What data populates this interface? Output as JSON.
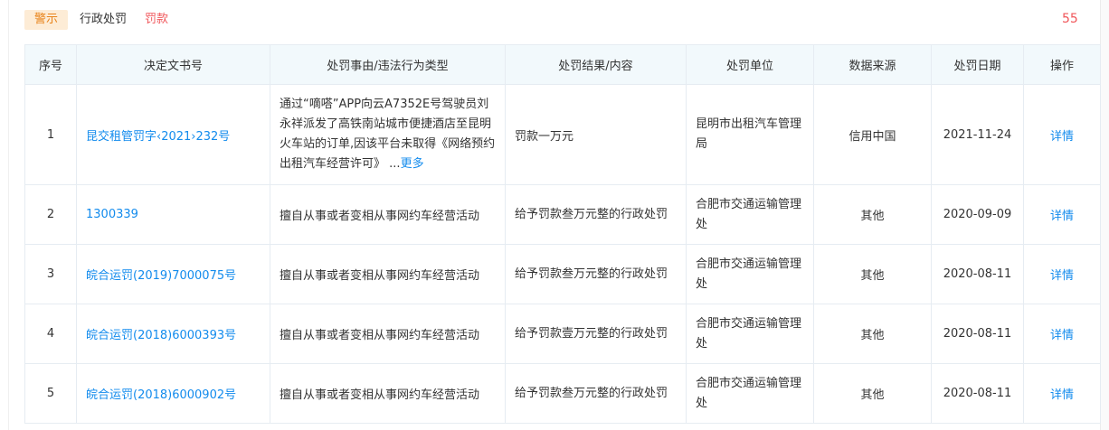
{
  "tabs": {
    "warning": "警示",
    "admin_penalty": "行政处罚",
    "fine": "罚款"
  },
  "count": "55",
  "table": {
    "headers": [
      "序号",
      "决定文书号",
      "处罚事由/违法行为类型",
      "处罚结果/内容",
      "处罚单位",
      "数据来源",
      "处罚日期",
      "操作"
    ],
    "rows": [
      {
        "index": "1",
        "doc_no": "昆交租管罚字‹2021›232号",
        "reason": "通过“嘀嗒”APP向云A7352E号驾驶员刘永祥派发了高铁南站城市便捷酒店至昆明火车站的订单,因该平台未取得《网络预约出租汽车经营许可》",
        "reason_ellipsis": "...",
        "reason_more": "更多",
        "result": "罚款一万元",
        "unit": "昆明市出租汽车管理局",
        "source": "信用中国",
        "date": "2021-11-24",
        "action": "详情"
      },
      {
        "index": "2",
        "doc_no": "1300339",
        "reason": "擅自从事或者变相从事网约车经营活动",
        "result": "给予罚款叁万元整的行政处罚",
        "unit": "合肥市交通运输管理处",
        "source": "其他",
        "date": "2020-09-09",
        "action": "详情"
      },
      {
        "index": "3",
        "doc_no": "皖合运罚(2019)7000075号",
        "reason": "擅自从事或者变相从事网约车经营活动",
        "result": "给予罚款叁万元整的行政处罚",
        "unit": "合肥市交通运输管理处",
        "source": "其他",
        "date": "2020-08-11",
        "action": "详情"
      },
      {
        "index": "4",
        "doc_no": "皖合运罚(2018)6000393号",
        "reason": "擅自从事或者变相从事网约车经营活动",
        "result": "给予罚款壹万元整的行政处罚",
        "unit": "合肥市交通运输管理处",
        "source": "其他",
        "date": "2020-08-11",
        "action": "详情"
      },
      {
        "index": "5",
        "doc_no": "皖合运罚(2018)6000902号",
        "reason": "擅自从事或者变相从事网约车经营活动",
        "result": "给予罚款叁万元整的行政处罚",
        "unit": "合肥市交通运输管理处",
        "source": "其他",
        "date": "2020-08-11",
        "action": "详情"
      }
    ]
  },
  "colors": {
    "accent_link": "#128bed",
    "warning_tag_bg": "#fdecd6",
    "warning_tag_text": "#e8831a",
    "fine_red": "#f0565a",
    "header_bg": "#f2f9fc",
    "border": "#e6ecf2"
  }
}
